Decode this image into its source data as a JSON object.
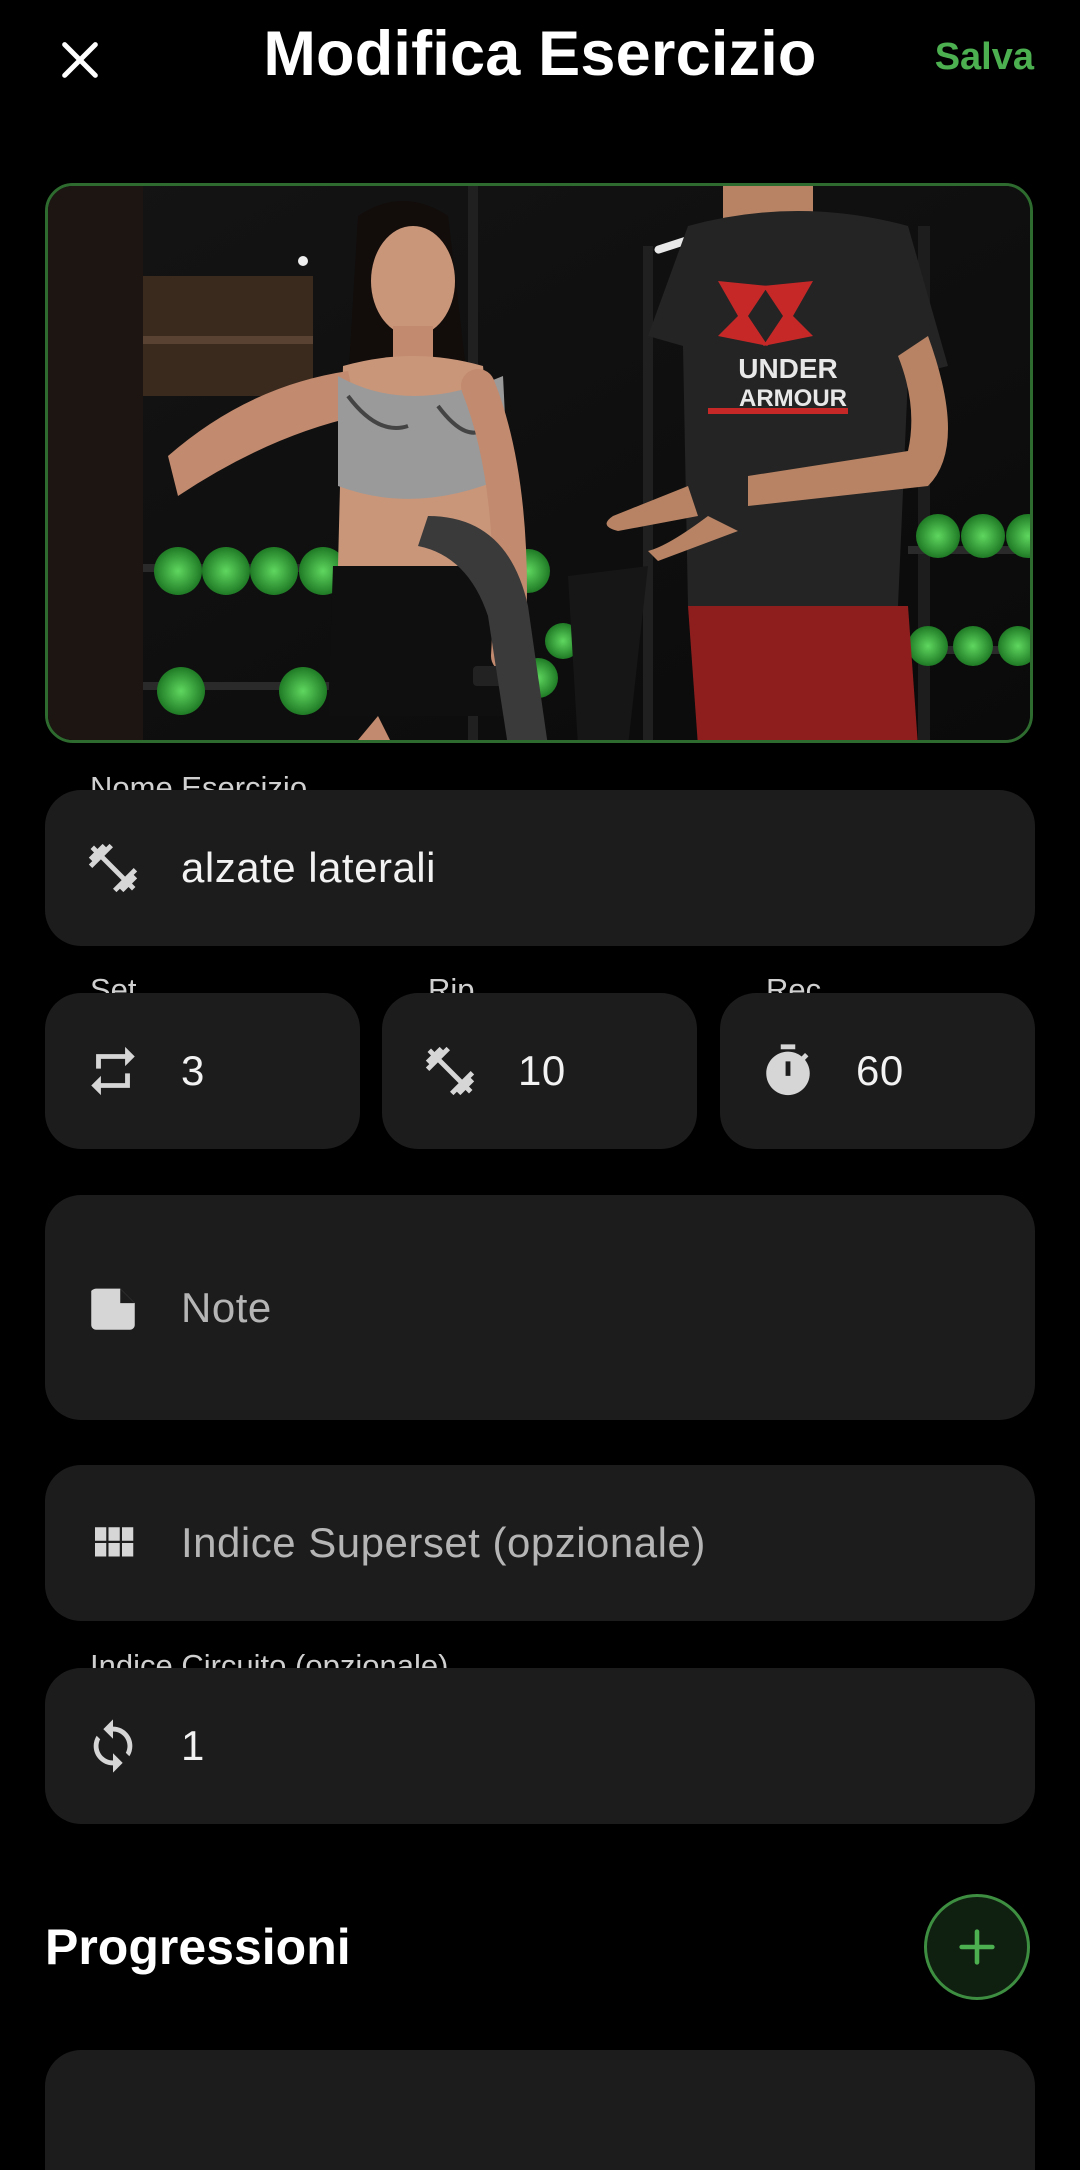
{
  "header": {
    "title": "Modifica Esercizio",
    "save_label": "Salva"
  },
  "media": {
    "description_icon": "exercise-photo",
    "brand_text": "UNDER ARMOUR"
  },
  "fields": {
    "name": {
      "label": "Nome Esercizio",
      "value": "alzate laterali",
      "icon": "dumbbell-icon"
    },
    "sets": {
      "label": "Set",
      "value": "3",
      "icon": "repeat-icon"
    },
    "reps": {
      "label": "Rip...",
      "value": "10",
      "icon": "dumbbell-icon"
    },
    "rest": {
      "label": "Rec...",
      "value": "60",
      "icon": "timer-icon"
    },
    "notes": {
      "placeholder": "Note",
      "icon": "note-icon"
    },
    "superset": {
      "placeholder": "Indice Superset (opzionale)",
      "icon": "grid-icon"
    },
    "circuit": {
      "label": "Indice Circuito (opzionale)",
      "value": "1",
      "icon": "sync-icon"
    }
  },
  "progressions": {
    "title": "Progressioni",
    "add_icon": "plus-icon"
  },
  "colors": {
    "accent": "#4caf50",
    "field_bg": "#1c1c1c",
    "background": "#000000"
  }
}
